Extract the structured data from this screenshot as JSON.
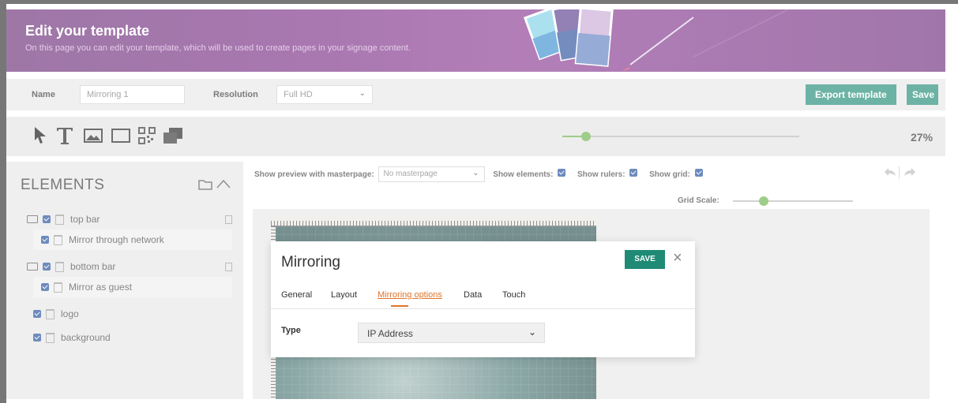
{
  "header": {
    "title": "Edit your template",
    "subtitle": "On this page you can edit your template, which will be used to create pages in your signage content."
  },
  "settings": {
    "name_label": "Name",
    "name_value": "Mirroring 1",
    "resolution_label": "Resolution",
    "resolution_value": "Full HD",
    "export_label": "Export template",
    "save_label": "Save"
  },
  "toolbar": {
    "tools": [
      "pointer-icon",
      "text-icon",
      "image-icon",
      "rectangle-icon",
      "qr-icon",
      "widget-icon"
    ],
    "zoom_text": "27%",
    "zoom_level": 0.1
  },
  "elements": {
    "title": "ELEMENTS",
    "items": [
      {
        "label": "top bar",
        "type": "group"
      },
      {
        "label": "Mirror through network",
        "type": "child"
      },
      {
        "label": "bottom bar",
        "type": "group"
      },
      {
        "label": "Mirror as guest",
        "type": "child"
      },
      {
        "label": "logo",
        "type": "item"
      },
      {
        "label": "background",
        "type": "item"
      }
    ]
  },
  "options": {
    "preview_label": "Show preview with masterpage:",
    "masterpage_value": "No masterpage",
    "show_elements_label": "Show elements:",
    "show_rulers_label": "Show rulers:",
    "show_grid_label": "Show grid:",
    "grid_scale_label": "Grid Scale:"
  },
  "modal": {
    "title": "Mirroring",
    "save_label": "SAVE",
    "tabs": [
      "General",
      "Layout",
      "Mirroring options",
      "Data",
      "Touch"
    ],
    "active_tab": "Mirroring options",
    "type_label": "Type",
    "type_value": "IP Address"
  },
  "colors": {
    "banner": "#7a2f85",
    "accent": "#1f8a75",
    "active_tab": "#e0742a",
    "slider": "#6bb34a"
  }
}
